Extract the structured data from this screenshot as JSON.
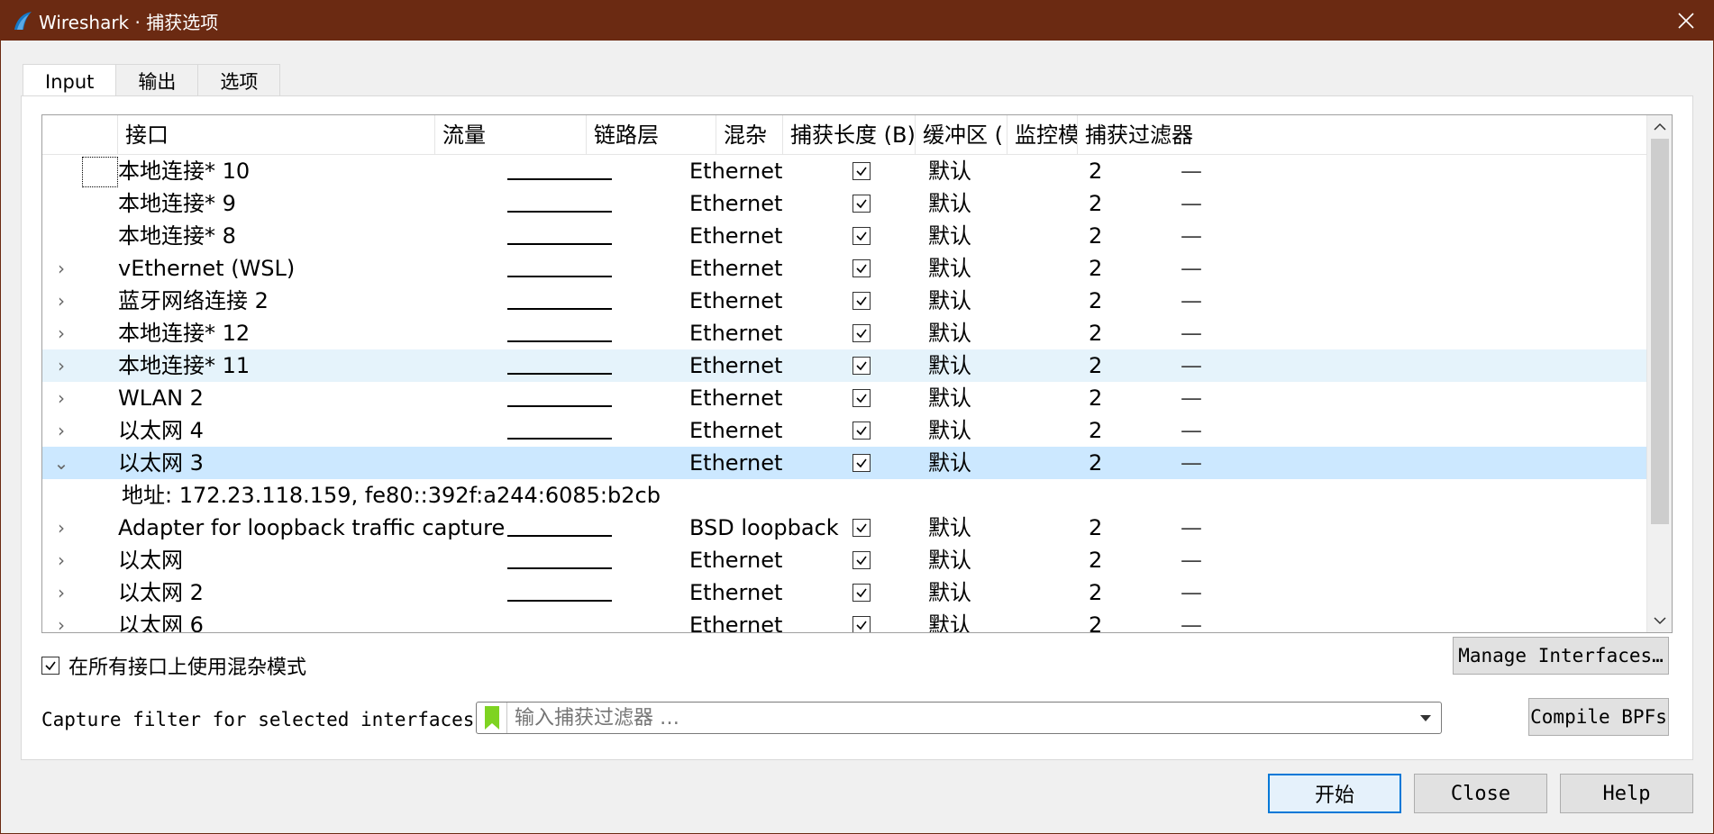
{
  "window": {
    "title": "Wireshark · 捕获选项",
    "colors": {
      "titlebar": "#6b2a12",
      "selection_strong": "#cce8ff",
      "selection_light": "#e5f3fb",
      "primary_border": "#0078d7",
      "filter_bookmark": "#7ed321"
    }
  },
  "tabs": [
    {
      "label": "Input",
      "active": true
    },
    {
      "label": "输出",
      "active": false
    },
    {
      "label": "选项",
      "active": false
    }
  ],
  "table": {
    "columns": [
      "接口",
      "流量",
      "链路层",
      "混杂",
      "捕获长度 (B)",
      "缓冲区 (",
      "监控模",
      "捕获过滤器"
    ],
    "rows": [
      {
        "expander": "",
        "iface": "本地连接* 10",
        "link": "Ethernet",
        "snap": "默认",
        "buf": "2",
        "mon": "—",
        "hl": "",
        "focus": true,
        "has_traffic": true,
        "promisc": true
      },
      {
        "expander": "",
        "iface": "本地连接* 9",
        "link": "Ethernet",
        "snap": "默认",
        "buf": "2",
        "mon": "—",
        "hl": "",
        "has_traffic": true,
        "promisc": true
      },
      {
        "expander": "",
        "iface": "本地连接* 8",
        "link": "Ethernet",
        "snap": "默认",
        "buf": "2",
        "mon": "—",
        "hl": "",
        "has_traffic": true,
        "promisc": true
      },
      {
        "expander": "›",
        "iface": "vEthernet (WSL)",
        "link": "Ethernet",
        "snap": "默认",
        "buf": "2",
        "mon": "—",
        "hl": "",
        "has_traffic": true,
        "promisc": true
      },
      {
        "expander": "›",
        "iface": "蓝牙网络连接 2",
        "link": "Ethernet",
        "snap": "默认",
        "buf": "2",
        "mon": "—",
        "hl": "",
        "has_traffic": true,
        "promisc": true
      },
      {
        "expander": "›",
        "iface": "本地连接* 12",
        "link": "Ethernet",
        "snap": "默认",
        "buf": "2",
        "mon": "—",
        "hl": "",
        "has_traffic": true,
        "promisc": true
      },
      {
        "expander": "›",
        "iface": "本地连接* 11",
        "link": "Ethernet",
        "snap": "默认",
        "buf": "2",
        "mon": "—",
        "hl": "light",
        "has_traffic": true,
        "promisc": true
      },
      {
        "expander": "›",
        "iface": "WLAN 2",
        "link": "Ethernet",
        "snap": "默认",
        "buf": "2",
        "mon": "—",
        "hl": "",
        "has_traffic": true,
        "promisc": true
      },
      {
        "expander": "›",
        "iface": "以太网 4",
        "link": "Ethernet",
        "snap": "默认",
        "buf": "2",
        "mon": "—",
        "hl": "",
        "has_traffic": true,
        "promisc": true
      },
      {
        "expander": "⌄",
        "iface": "以太网 3",
        "link": "Ethernet",
        "snap": "默认",
        "buf": "2",
        "mon": "—",
        "hl": "strong",
        "has_traffic": false,
        "promisc": true
      },
      {
        "address": "地址: 172.23.118.159, fe80::392f:a244:6085:b2cb"
      },
      {
        "expander": "›",
        "iface": "Adapter for loopback traffic capture",
        "link": "BSD loopback",
        "snap": "默认",
        "buf": "2",
        "mon": "—",
        "hl": "",
        "has_traffic": true,
        "promisc": true
      },
      {
        "expander": "›",
        "iface": "以太网",
        "link": "Ethernet",
        "snap": "默认",
        "buf": "2",
        "mon": "—",
        "hl": "",
        "has_traffic": true,
        "promisc": true
      },
      {
        "expander": "›",
        "iface": "以太网 2",
        "link": "Ethernet",
        "snap": "默认",
        "buf": "2",
        "mon": "—",
        "hl": "",
        "has_traffic": true,
        "promisc": true
      },
      {
        "expander": "›",
        "iface": "以太网 6",
        "link": "Ethernet",
        "snap": "默认",
        "buf": "2",
        "mon": "—",
        "hl": "",
        "has_traffic": false,
        "promisc": true
      }
    ]
  },
  "promisc_all": {
    "label": "在所有接口上使用混杂模式",
    "checked": true
  },
  "manage_interfaces_label": "Manage Interfaces…",
  "capture_filter": {
    "label": "Capture filter for selected interfaces:",
    "placeholder": "输入捕获过滤器 …"
  },
  "compile_bpfs_label": "Compile BPFs",
  "buttons": {
    "start": "开始",
    "close": "Close",
    "help": "Help"
  }
}
